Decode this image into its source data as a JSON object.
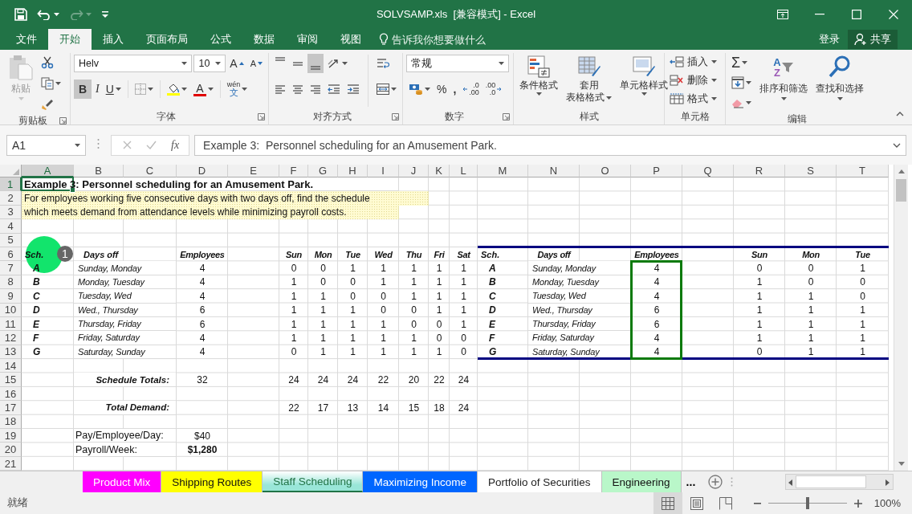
{
  "window": {
    "title": "SOLVSAMP.xls  [兼容模式] - Excel",
    "redo_disabled": true
  },
  "ribbon_tabs": [
    {
      "label": "文件",
      "selected": false
    },
    {
      "label": "开始",
      "selected": true
    },
    {
      "label": "插入",
      "selected": false
    },
    {
      "label": "页面布局",
      "selected": false
    },
    {
      "label": "公式",
      "selected": false
    },
    {
      "label": "数据",
      "selected": false
    },
    {
      "label": "审阅",
      "selected": false
    },
    {
      "label": "视图",
      "selected": false
    }
  ],
  "tell_me": {
    "placeholder": "告诉我你想要做什么"
  },
  "account": {
    "sign_in": "登录",
    "share": "共享"
  },
  "ribbon": {
    "clipboard": {
      "label": "剪贴板",
      "paste": "粘贴",
      "paste_disabled": true
    },
    "font": {
      "label": "字体",
      "font_name": "Helv",
      "font_size": "10",
      "grow_glyph": "A",
      "shrink_glyph": "A",
      "bold": {
        "glyph": "B",
        "on": true
      },
      "italic": {
        "glyph": "I",
        "on": false
      },
      "underline": {
        "glyph": "U",
        "on": false
      },
      "font_color_glyph": "A",
      "phonetic": {
        "top": "wén",
        "bottom": "文"
      }
    },
    "alignment": {
      "label": "对齐方式",
      "vertical": [
        {
          "selected": false
        },
        {
          "selected": false
        },
        {
          "selected": true
        }
      ]
    },
    "number": {
      "label": "数字",
      "format": "常规",
      "percent": "%",
      "comma": ",",
      "increase_decimal": {
        "top": ".0",
        "bottom": ".00"
      },
      "decrease_decimal": {
        "top": ".00",
        "bottom": ".0"
      }
    },
    "styles": {
      "label": "样式",
      "buttons": [
        {
          "lines": [
            "条件格式"
          ],
          "kind": "conditional"
        },
        {
          "lines": [
            "套用",
            "表格格式"
          ],
          "kind": "table"
        },
        {
          "lines": [
            "单元格样式"
          ],
          "kind": "cell"
        }
      ]
    },
    "cells": {
      "label": "单元格",
      "buttons": [
        {
          "label": "插入",
          "kind": "insert"
        },
        {
          "label": "删除",
          "kind": "delete"
        },
        {
          "label": "格式",
          "kind": "format"
        }
      ]
    },
    "editing": {
      "label": "编辑",
      "sum_glyph": "Σ",
      "sort": {
        "label": "排序和筛选",
        "glyph_top": "A",
        "glyph_bottom": "Z"
      },
      "find": {
        "label": "查找和选择"
      }
    }
  },
  "formula_bar": {
    "name_box": "A1",
    "fx": "fx",
    "value": "Example 3:  Personnel scheduling for an Amusement Park."
  },
  "sheet": {
    "columns": [
      {
        "label": "A",
        "selected": true
      },
      {
        "label": "B",
        "selected": false
      },
      {
        "label": "C",
        "selected": false
      },
      {
        "label": "D",
        "selected": false
      },
      {
        "label": "E",
        "selected": false
      },
      {
        "label": "F",
        "selected": false
      },
      {
        "label": "G",
        "selected": false
      },
      {
        "label": "H",
        "selected": false
      },
      {
        "label": "I",
        "selected": false
      },
      {
        "label": "J",
        "selected": false
      },
      {
        "label": "K",
        "selected": false
      },
      {
        "label": "L",
        "selected": false
      },
      {
        "label": "M",
        "selected": false
      },
      {
        "label": "N",
        "selected": false
      },
      {
        "label": "O",
        "selected": false
      },
      {
        "label": "P",
        "selected": false
      },
      {
        "label": "Q",
        "selected": false
      },
      {
        "label": "R",
        "selected": false
      },
      {
        "label": "S",
        "selected": false
      },
      {
        "label": "T",
        "selected": false
      }
    ],
    "rows": [
      {
        "label": "1",
        "selected": true,
        "cells": {
          "A": {
            "text": "Example 3:  Personnel scheduling for an Amusement Park.",
            "kind": "title",
            "selected": true
          }
        }
      },
      {
        "label": "2",
        "selected": false,
        "cells": {
          "A": {
            "text": "For employees working five consecutive days with two days off, find the schedule",
            "kind": "note",
            "highlighted": true
          }
        }
      },
      {
        "label": "3",
        "selected": false,
        "cells": {
          "A": {
            "text": "which meets demand from attendance levels while minimizing payroll costs.",
            "kind": "note",
            "highlighted": true
          }
        }
      },
      {
        "label": "4",
        "selected": false,
        "cells": {}
      },
      {
        "label": "5",
        "selected": false,
        "cells": {}
      },
      {
        "label": "6",
        "selected": false,
        "cells": {
          "A": {
            "text": "Sch.",
            "kind": "head-left"
          },
          "B": {
            "text": "Days off",
            "kind": "head-indent"
          },
          "D": {
            "text": "Employees",
            "kind": "head"
          },
          "F": {
            "text": "Sun",
            "kind": "head"
          },
          "G": {
            "text": "Mon",
            "kind": "head"
          },
          "H": {
            "text": "Tue",
            "kind": "head"
          },
          "I": {
            "text": "Wed",
            "kind": "head"
          },
          "J": {
            "text": "Thu",
            "kind": "head"
          },
          "K": {
            "text": "Fri",
            "kind": "head"
          },
          "L": {
            "text": "Sat",
            "kind": "head"
          },
          "M": {
            "text": "Sch.",
            "kind": "head-left"
          },
          "N": {
            "text": "Days off",
            "kind": "head"
          },
          "P": {
            "text": "Employees",
            "kind": "head"
          },
          "R": {
            "text": "Sun",
            "kind": "head"
          },
          "S": {
            "text": "Mon",
            "kind": "head"
          },
          "T": {
            "text": "Tue",
            "kind": "head"
          }
        }
      },
      {
        "label": "7",
        "selected": false,
        "cells": {
          "A": {
            "text": "A",
            "kind": "letter"
          },
          "B": {
            "text": "Sunday, Monday",
            "kind": "italic"
          },
          "D": {
            "text": "4",
            "kind": "num"
          },
          "F": {
            "text": "0",
            "kind": "num"
          },
          "G": {
            "text": "0",
            "kind": "num"
          },
          "H": {
            "text": "1",
            "kind": "num"
          },
          "I": {
            "text": "1",
            "kind": "num"
          },
          "J": {
            "text": "1",
            "kind": "num"
          },
          "K": {
            "text": "1",
            "kind": "num"
          },
          "L": {
            "text": "1",
            "kind": "num"
          },
          "M": {
            "text": "A",
            "kind": "letter"
          },
          "N": {
            "text": "Sunday, Monday",
            "kind": "italic"
          },
          "P": {
            "text": "4",
            "kind": "num"
          },
          "R": {
            "text": "0",
            "kind": "num"
          },
          "S": {
            "text": "0",
            "kind": "num"
          },
          "T": {
            "text": "1",
            "kind": "num"
          }
        }
      },
      {
        "label": "8",
        "selected": false,
        "cells": {
          "A": {
            "text": "B",
            "kind": "letter"
          },
          "B": {
            "text": "Monday, Tuesday",
            "kind": "italic"
          },
          "D": {
            "text": "4",
            "kind": "num"
          },
          "F": {
            "text": "1",
            "kind": "num"
          },
          "G": {
            "text": "0",
            "kind": "num"
          },
          "H": {
            "text": "0",
            "kind": "num"
          },
          "I": {
            "text": "1",
            "kind": "num"
          },
          "J": {
            "text": "1",
            "kind": "num"
          },
          "K": {
            "text": "1",
            "kind": "num"
          },
          "L": {
            "text": "1",
            "kind": "num"
          },
          "M": {
            "text": "B",
            "kind": "letter"
          },
          "N": {
            "text": "Monday, Tuesday",
            "kind": "italic"
          },
          "P": {
            "text": "4",
            "kind": "num"
          },
          "R": {
            "text": "1",
            "kind": "num"
          },
          "S": {
            "text": "0",
            "kind": "num"
          },
          "T": {
            "text": "0",
            "kind": "num"
          }
        }
      },
      {
        "label": "9",
        "selected": false,
        "cells": {
          "A": {
            "text": "C",
            "kind": "letter"
          },
          "B": {
            "text": "Tuesday, Wed",
            "kind": "italic"
          },
          "D": {
            "text": "4",
            "kind": "num"
          },
          "F": {
            "text": "1",
            "kind": "num"
          },
          "G": {
            "text": "1",
            "kind": "num"
          },
          "H": {
            "text": "0",
            "kind": "num"
          },
          "I": {
            "text": "0",
            "kind": "num"
          },
          "J": {
            "text": "1",
            "kind": "num"
          },
          "K": {
            "text": "1",
            "kind": "num"
          },
          "L": {
            "text": "1",
            "kind": "num"
          },
          "M": {
            "text": "C",
            "kind": "letter"
          },
          "N": {
            "text": "Tuesday, Wed",
            "kind": "italic"
          },
          "P": {
            "text": "4",
            "kind": "num"
          },
          "R": {
            "text": "1",
            "kind": "num"
          },
          "S": {
            "text": "1",
            "kind": "num"
          },
          "T": {
            "text": "0",
            "kind": "num"
          }
        }
      },
      {
        "label": "10",
        "selected": false,
        "cells": {
          "A": {
            "text": "D",
            "kind": "letter"
          },
          "B": {
            "text": "Wed., Thursday",
            "kind": "italic"
          },
          "D": {
            "text": "6",
            "kind": "num"
          },
          "F": {
            "text": "1",
            "kind": "num"
          },
          "G": {
            "text": "1",
            "kind": "num"
          },
          "H": {
            "text": "1",
            "kind": "num"
          },
          "I": {
            "text": "0",
            "kind": "num"
          },
          "J": {
            "text": "0",
            "kind": "num"
          },
          "K": {
            "text": "1",
            "kind": "num"
          },
          "L": {
            "text": "1",
            "kind": "num"
          },
          "M": {
            "text": "D",
            "kind": "letter"
          },
          "N": {
            "text": "Wed., Thursday",
            "kind": "italic"
          },
          "P": {
            "text": "6",
            "kind": "num"
          },
          "R": {
            "text": "1",
            "kind": "num"
          },
          "S": {
            "text": "1",
            "kind": "num"
          },
          "T": {
            "text": "1",
            "kind": "num"
          }
        }
      },
      {
        "label": "11",
        "selected": false,
        "cells": {
          "A": {
            "text": "E",
            "kind": "letter"
          },
          "B": {
            "text": "Thursday, Friday",
            "kind": "italic"
          },
          "D": {
            "text": "6",
            "kind": "num"
          },
          "F": {
            "text": "1",
            "kind": "num"
          },
          "G": {
            "text": "1",
            "kind": "num"
          },
          "H": {
            "text": "1",
            "kind": "num"
          },
          "I": {
            "text": "1",
            "kind": "num"
          },
          "J": {
            "text": "0",
            "kind": "num"
          },
          "K": {
            "text": "0",
            "kind": "num"
          },
          "L": {
            "text": "1",
            "kind": "num"
          },
          "M": {
            "text": "E",
            "kind": "letter"
          },
          "N": {
            "text": "Thursday, Friday",
            "kind": "italic"
          },
          "P": {
            "text": "6",
            "kind": "num"
          },
          "R": {
            "text": "1",
            "kind": "num"
          },
          "S": {
            "text": "1",
            "kind": "num"
          },
          "T": {
            "text": "1",
            "kind": "num"
          }
        }
      },
      {
        "label": "12",
        "selected": false,
        "cells": {
          "A": {
            "text": "F",
            "kind": "letter"
          },
          "B": {
            "text": "Friday, Saturday",
            "kind": "italic"
          },
          "D": {
            "text": "4",
            "kind": "num"
          },
          "F": {
            "text": "1",
            "kind": "num"
          },
          "G": {
            "text": "1",
            "kind": "num"
          },
          "H": {
            "text": "1",
            "kind": "num"
          },
          "I": {
            "text": "1",
            "kind": "num"
          },
          "J": {
            "text": "1",
            "kind": "num"
          },
          "K": {
            "text": "0",
            "kind": "num"
          },
          "L": {
            "text": "0",
            "kind": "num"
          },
          "M": {
            "text": "F",
            "kind": "letter"
          },
          "N": {
            "text": "Friday, Saturday",
            "kind": "italic"
          },
          "P": {
            "text": "4",
            "kind": "num"
          },
          "R": {
            "text": "1",
            "kind": "num"
          },
          "S": {
            "text": "1",
            "kind": "num"
          },
          "T": {
            "text": "1",
            "kind": "num"
          }
        }
      },
      {
        "label": "13",
        "selected": false,
        "cells": {
          "A": {
            "text": "G",
            "kind": "letter"
          },
          "B": {
            "text": "Saturday, Sunday",
            "kind": "italic"
          },
          "D": {
            "text": "4",
            "kind": "num"
          },
          "F": {
            "text": "0",
            "kind": "num"
          },
          "G": {
            "text": "1",
            "kind": "num"
          },
          "H": {
            "text": "1",
            "kind": "num"
          },
          "I": {
            "text": "1",
            "kind": "num"
          },
          "J": {
            "text": "1",
            "kind": "num"
          },
          "K": {
            "text": "1",
            "kind": "num"
          },
          "L": {
            "text": "0",
            "kind": "num"
          },
          "M": {
            "text": "G",
            "kind": "letter"
          },
          "N": {
            "text": "Saturday, Sunday",
            "kind": "italic"
          },
          "P": {
            "text": "4",
            "kind": "num"
          },
          "R": {
            "text": "0",
            "kind": "num"
          },
          "S": {
            "text": "1",
            "kind": "num"
          },
          "T": {
            "text": "1",
            "kind": "num"
          }
        }
      },
      {
        "label": "14",
        "selected": false,
        "cells": {}
      },
      {
        "label": "15",
        "selected": false,
        "cells": {
          "B": {
            "text": "Schedule Totals:",
            "kind": "label"
          },
          "D": {
            "text": "32",
            "kind": "num"
          },
          "F": {
            "text": "24",
            "kind": "num"
          },
          "G": {
            "text": "24",
            "kind": "num"
          },
          "H": {
            "text": "24",
            "kind": "num"
          },
          "I": {
            "text": "22",
            "kind": "num"
          },
          "J": {
            "text": "20",
            "kind": "num"
          },
          "K": {
            "text": "22",
            "kind": "num"
          },
          "L": {
            "text": "24",
            "kind": "num"
          }
        }
      },
      {
        "label": "16",
        "selected": false,
        "cells": {}
      },
      {
        "label": "17",
        "selected": false,
        "cells": {
          "B": {
            "text": "Total Demand:",
            "kind": "label"
          },
          "F": {
            "text": "22",
            "kind": "num"
          },
          "G": {
            "text": "17",
            "kind": "num"
          },
          "H": {
            "text": "13",
            "kind": "num"
          },
          "I": {
            "text": "14",
            "kind": "num"
          },
          "J": {
            "text": "15",
            "kind": "num"
          },
          "K": {
            "text": "18",
            "kind": "num"
          },
          "L": {
            "text": "24",
            "kind": "num"
          }
        }
      },
      {
        "label": "18",
        "selected": false,
        "cells": {}
      },
      {
        "label": "19",
        "selected": false,
        "cells": {
          "B": {
            "text": "Pay/Employee/Day:",
            "kind": "text"
          },
          "D": {
            "text": "$40",
            "kind": "num"
          }
        }
      },
      {
        "label": "20",
        "selected": false,
        "cells": {
          "B": {
            "text": "Payroll/Week:",
            "kind": "text"
          },
          "D": {
            "text": "$1,280",
            "kind": "num-bold"
          }
        }
      },
      {
        "label": "21",
        "selected": false,
        "cells": {}
      }
    ],
    "click_marker": {
      "step": "1"
    }
  },
  "sheet_tabs": {
    "tabs": [
      {
        "label": "Product Mix",
        "color": "#ff00ff",
        "selected": false
      },
      {
        "label": "Shipping Routes",
        "color": "#ffff00",
        "selected": false
      },
      {
        "label": "Staff Scheduling",
        "color": "#99e6d8",
        "selected": true
      },
      {
        "label": "Maximizing Income",
        "color": "#0066ff",
        "selected": false
      },
      {
        "label": "Portfolio of Securities",
        "selected": false
      },
      {
        "label": "Engineering",
        "color": "#b9f7c9",
        "selected": false
      }
    ],
    "more": "..."
  },
  "status_bar": {
    "text": "就绪",
    "views": [
      {
        "kind": "normal",
        "selected": true
      },
      {
        "kind": "page-layout",
        "selected": false
      },
      {
        "kind": "page-break",
        "selected": false
      }
    ],
    "zoom": {
      "level": 0.5,
      "label": "100%"
    }
  }
}
